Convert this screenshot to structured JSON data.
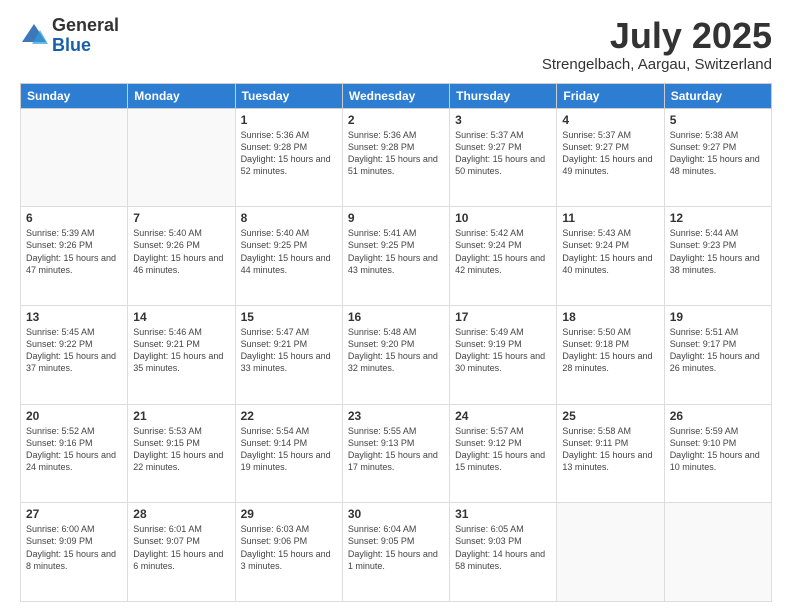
{
  "logo": {
    "general": "General",
    "blue": "Blue"
  },
  "title": "July 2025",
  "location": "Strengelbach, Aargau, Switzerland",
  "weekdays": [
    "Sunday",
    "Monday",
    "Tuesday",
    "Wednesday",
    "Thursday",
    "Friday",
    "Saturday"
  ],
  "days": [
    {
      "num": "",
      "sunrise": "",
      "sunset": "",
      "daylight": ""
    },
    {
      "num": "",
      "sunrise": "",
      "sunset": "",
      "daylight": ""
    },
    {
      "num": "1",
      "sunrise": "Sunrise: 5:36 AM",
      "sunset": "Sunset: 9:28 PM",
      "daylight": "Daylight: 15 hours and 52 minutes."
    },
    {
      "num": "2",
      "sunrise": "Sunrise: 5:36 AM",
      "sunset": "Sunset: 9:28 PM",
      "daylight": "Daylight: 15 hours and 51 minutes."
    },
    {
      "num": "3",
      "sunrise": "Sunrise: 5:37 AM",
      "sunset": "Sunset: 9:27 PM",
      "daylight": "Daylight: 15 hours and 50 minutes."
    },
    {
      "num": "4",
      "sunrise": "Sunrise: 5:37 AM",
      "sunset": "Sunset: 9:27 PM",
      "daylight": "Daylight: 15 hours and 49 minutes."
    },
    {
      "num": "5",
      "sunrise": "Sunrise: 5:38 AM",
      "sunset": "Sunset: 9:27 PM",
      "daylight": "Daylight: 15 hours and 48 minutes."
    },
    {
      "num": "6",
      "sunrise": "Sunrise: 5:39 AM",
      "sunset": "Sunset: 9:26 PM",
      "daylight": "Daylight: 15 hours and 47 minutes."
    },
    {
      "num": "7",
      "sunrise": "Sunrise: 5:40 AM",
      "sunset": "Sunset: 9:26 PM",
      "daylight": "Daylight: 15 hours and 46 minutes."
    },
    {
      "num": "8",
      "sunrise": "Sunrise: 5:40 AM",
      "sunset": "Sunset: 9:25 PM",
      "daylight": "Daylight: 15 hours and 44 minutes."
    },
    {
      "num": "9",
      "sunrise": "Sunrise: 5:41 AM",
      "sunset": "Sunset: 9:25 PM",
      "daylight": "Daylight: 15 hours and 43 minutes."
    },
    {
      "num": "10",
      "sunrise": "Sunrise: 5:42 AM",
      "sunset": "Sunset: 9:24 PM",
      "daylight": "Daylight: 15 hours and 42 minutes."
    },
    {
      "num": "11",
      "sunrise": "Sunrise: 5:43 AM",
      "sunset": "Sunset: 9:24 PM",
      "daylight": "Daylight: 15 hours and 40 minutes."
    },
    {
      "num": "12",
      "sunrise": "Sunrise: 5:44 AM",
      "sunset": "Sunset: 9:23 PM",
      "daylight": "Daylight: 15 hours and 38 minutes."
    },
    {
      "num": "13",
      "sunrise": "Sunrise: 5:45 AM",
      "sunset": "Sunset: 9:22 PM",
      "daylight": "Daylight: 15 hours and 37 minutes."
    },
    {
      "num": "14",
      "sunrise": "Sunrise: 5:46 AM",
      "sunset": "Sunset: 9:21 PM",
      "daylight": "Daylight: 15 hours and 35 minutes."
    },
    {
      "num": "15",
      "sunrise": "Sunrise: 5:47 AM",
      "sunset": "Sunset: 9:21 PM",
      "daylight": "Daylight: 15 hours and 33 minutes."
    },
    {
      "num": "16",
      "sunrise": "Sunrise: 5:48 AM",
      "sunset": "Sunset: 9:20 PM",
      "daylight": "Daylight: 15 hours and 32 minutes."
    },
    {
      "num": "17",
      "sunrise": "Sunrise: 5:49 AM",
      "sunset": "Sunset: 9:19 PM",
      "daylight": "Daylight: 15 hours and 30 minutes."
    },
    {
      "num": "18",
      "sunrise": "Sunrise: 5:50 AM",
      "sunset": "Sunset: 9:18 PM",
      "daylight": "Daylight: 15 hours and 28 minutes."
    },
    {
      "num": "19",
      "sunrise": "Sunrise: 5:51 AM",
      "sunset": "Sunset: 9:17 PM",
      "daylight": "Daylight: 15 hours and 26 minutes."
    },
    {
      "num": "20",
      "sunrise": "Sunrise: 5:52 AM",
      "sunset": "Sunset: 9:16 PM",
      "daylight": "Daylight: 15 hours and 24 minutes."
    },
    {
      "num": "21",
      "sunrise": "Sunrise: 5:53 AM",
      "sunset": "Sunset: 9:15 PM",
      "daylight": "Daylight: 15 hours and 22 minutes."
    },
    {
      "num": "22",
      "sunrise": "Sunrise: 5:54 AM",
      "sunset": "Sunset: 9:14 PM",
      "daylight": "Daylight: 15 hours and 19 minutes."
    },
    {
      "num": "23",
      "sunrise": "Sunrise: 5:55 AM",
      "sunset": "Sunset: 9:13 PM",
      "daylight": "Daylight: 15 hours and 17 minutes."
    },
    {
      "num": "24",
      "sunrise": "Sunrise: 5:57 AM",
      "sunset": "Sunset: 9:12 PM",
      "daylight": "Daylight: 15 hours and 15 minutes."
    },
    {
      "num": "25",
      "sunrise": "Sunrise: 5:58 AM",
      "sunset": "Sunset: 9:11 PM",
      "daylight": "Daylight: 15 hours and 13 minutes."
    },
    {
      "num": "26",
      "sunrise": "Sunrise: 5:59 AM",
      "sunset": "Sunset: 9:10 PM",
      "daylight": "Daylight: 15 hours and 10 minutes."
    },
    {
      "num": "27",
      "sunrise": "Sunrise: 6:00 AM",
      "sunset": "Sunset: 9:09 PM",
      "daylight": "Daylight: 15 hours and 8 minutes."
    },
    {
      "num": "28",
      "sunrise": "Sunrise: 6:01 AM",
      "sunset": "Sunset: 9:07 PM",
      "daylight": "Daylight: 15 hours and 6 minutes."
    },
    {
      "num": "29",
      "sunrise": "Sunrise: 6:03 AM",
      "sunset": "Sunset: 9:06 PM",
      "daylight": "Daylight: 15 hours and 3 minutes."
    },
    {
      "num": "30",
      "sunrise": "Sunrise: 6:04 AM",
      "sunset": "Sunset: 9:05 PM",
      "daylight": "Daylight: 15 hours and 1 minute."
    },
    {
      "num": "31",
      "sunrise": "Sunrise: 6:05 AM",
      "sunset": "Sunset: 9:03 PM",
      "daylight": "Daylight: 14 hours and 58 minutes."
    },
    {
      "num": "",
      "sunrise": "",
      "sunset": "",
      "daylight": ""
    },
    {
      "num": "",
      "sunrise": "",
      "sunset": "",
      "daylight": ""
    }
  ]
}
